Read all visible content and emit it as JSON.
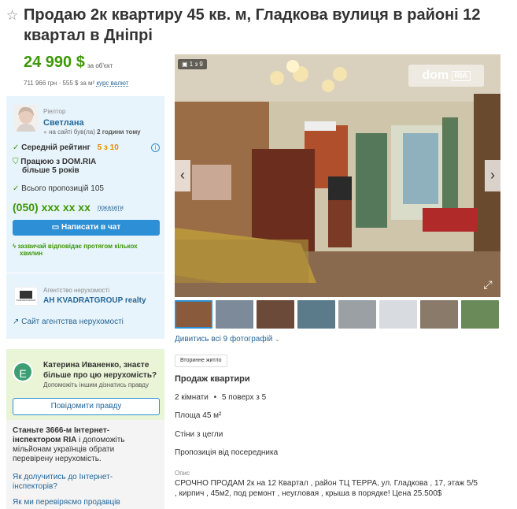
{
  "title": "Продаю 2к квартиру 45 кв. м, Гладкова вулиця в районі 12 квартал в Дніпрі",
  "price": {
    "main": "24 990 $",
    "per_object": "за об'єкт",
    "alt_uah": "711 966 грн",
    "per_m2": "555 $ за м²",
    "rate_link": "курс валют"
  },
  "realtor": {
    "role": "Ріелтор",
    "name": "Светлана",
    "status_prefix": "на сайті був(ла)",
    "status_time": "2 години тому",
    "rating_label": "Середній рейтинг",
    "rating_value": "5 з 10",
    "domria_years_line1": "Працюю з DOM.RIA",
    "domria_years_line2": "більше 5 років",
    "offers": "Всього пропозицій 105",
    "phone": "(050) xxx xx xx",
    "show_phone": "показати",
    "chat_button": "Написати в чат",
    "reply_line1": "зазвичай відповідає протягом кількох",
    "reply_line2": "хвилин"
  },
  "agency": {
    "role": "Агентство нерухомості",
    "name": "АН KVADRATGROUP realty",
    "logo_text": "KVADRATGROUP",
    "site_link": "Сайт агентства нерухомості"
  },
  "gallery": {
    "counter": "1 з 9",
    "logo_dom": "dom",
    "logo_ria": "RIA",
    "prev": "‹",
    "next": "›",
    "all_photos": "Дивитись всі 9 фотографій"
  },
  "thumbnails": [
    {
      "color": "#8a5a3c"
    },
    {
      "color": "#7d8a9a"
    },
    {
      "color": "#6b4a3a"
    },
    {
      "color": "#5b7a8a"
    },
    {
      "color": "#9aa0a4"
    },
    {
      "color": "#d8dbe0"
    },
    {
      "color": "#8a7a6a"
    },
    {
      "color": "#6b8a5a"
    }
  ],
  "listing": {
    "badge": "Вторинне житло",
    "section_title": "Продаж квартири",
    "rooms": "2 кімнати",
    "floor": "5 поверх з 5",
    "area": "Площа 45 м²",
    "walls": "Стіни з цегли",
    "offer_from": "Пропозиція від посередника",
    "desc_label": "Опис",
    "desc_line1": "СРОЧНО ПРОДАМ 2к на 12 Квартал , район ТЦ ТЕРРА, ул. Гладкова , 17, этаж 5/5",
    "desc_line2": ", кирпич , 45м2, под ремонт , неугловая , крыша в порядке! Цена 25.500$"
  },
  "inspector": {
    "avatar_letter": "E",
    "question_line1": "Катерина Иваненко, знаєте",
    "question_line2": "більше про цю нерухомість?",
    "hint": "Допоможіть іншим дізнатись правду",
    "report_button": "Повідомити правду",
    "become_bold_line1": "Станьте 3666-м Інтернет-",
    "become_bold_line2": "інспектором RIA",
    "become_rest_line2": " і допоможіть",
    "become_line3": "мільйонам українців обрати",
    "become_line4": "перевірену нерухомість.",
    "link1_line1": "Як долучитись до Інтернет-",
    "link1_line2": "інспекторів?",
    "link2": "Як ми перевіряємо продавців"
  }
}
